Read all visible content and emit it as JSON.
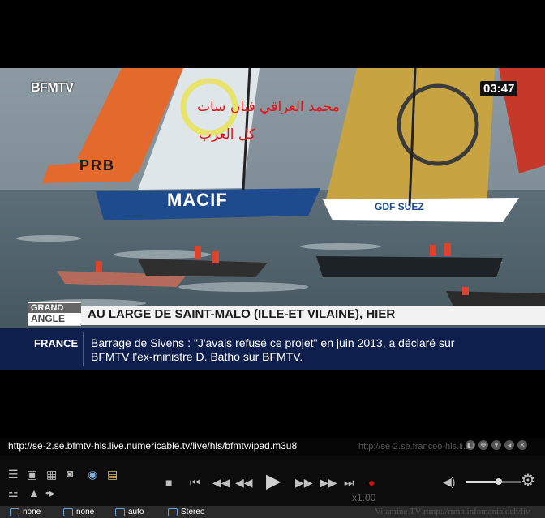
{
  "video": {
    "channel_logo": "BFMTV",
    "clock": "03:47",
    "watermark_line1": "محمد العراقي فنان سات",
    "watermark_line2": "كل العرب",
    "sail_texts": [
      "PRB",
      "MACIF",
      "GDF SUEZ"
    ],
    "banner_tag_line1": "GRAND",
    "banner_tag_line2": "ANGLE",
    "banner_title": "AU LARGE DE SAINT-MALO (ILLE-ET VILAINE), HIER",
    "ticker_region": "FRANCE",
    "ticker_text": "Barrage de Sivens : \"J'avais refusé ce projet\" en juin 2013, a déclaré sur BFMTV l'ex-ministre D. Batho sur BFMTV."
  },
  "player": {
    "url": "http://se-2.se.bfmtv-hls.live.numericable.tv/live/hls/bfmtv/ipad.m3u8",
    "ghost_url": "http://se-2.se.franceo-hls.li...",
    "speed": "x1.00",
    "volume_level": 0.6
  },
  "status_bar": {
    "items": [
      "none",
      "none",
      "auto",
      "Stereo"
    ],
    "footer_text": "Vitamine TV rtmp://rtmp.infomaniak.ch/liv"
  },
  "colors": {
    "watermark": "#e01515",
    "ticker_bg": "#0e1f4d",
    "record": "#d01010"
  }
}
